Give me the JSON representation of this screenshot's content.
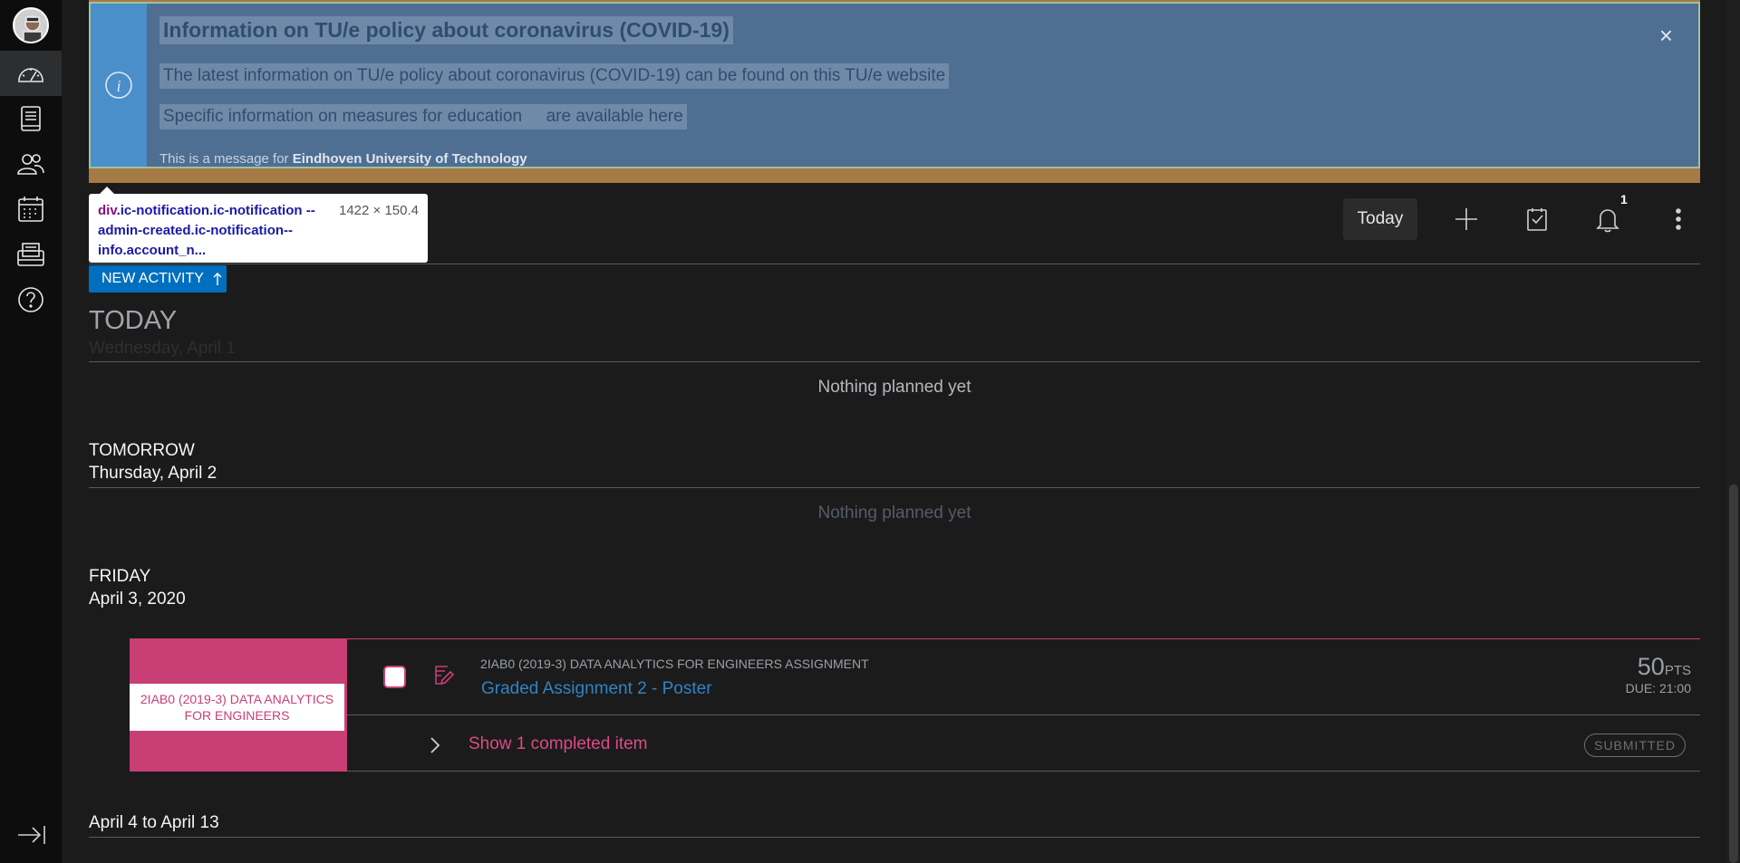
{
  "notification": {
    "title": "Information on TU/e policy about coronavirus (COVID-19)",
    "line1": "The latest information on TU/e policy about coronavirus (COVID-19) can be found on this TU/e website",
    "line2_a": "Specific information on measures for education",
    "line2_b": "are available here",
    "message_prefix": "This is a message for",
    "message_org": "Eindhoven University of Technology",
    "close": "×"
  },
  "devtools_tooltip": {
    "selector_tag": "div",
    "selector_classes": ".ic-notification.ic-notification --admin-created.ic-notification-- info.account_n...",
    "dimensions": "1422 × 150.4"
  },
  "header": {
    "today_button": "Today",
    "notification_count": "1",
    "icons": [
      "plus-icon",
      "todo-icon",
      "bell-icon",
      "more-vertical-icon"
    ]
  },
  "new_activity_label": "NEW ACTIVITY",
  "days": [
    {
      "title": "TODAY",
      "date": "Wednesday, April 1",
      "empty_text": "Nothing planned yet"
    },
    {
      "title": "TOMORROW",
      "date": "Thursday, April 2",
      "empty_text": "Nothing planned yet"
    },
    {
      "title": "FRIDAY",
      "date": "April 3, 2020"
    }
  ],
  "activity": {
    "course_tile": "2IAB0 (2019-3) DATA ANALYTICS FOR ENGINEERS",
    "course_line": "2IAB0 (2019-3) DATA ANALYTICS FOR ENGINEERS ASSIGNMENT",
    "title": "Graded Assignment 2 - Poster",
    "points": "50",
    "points_unit": "PTS",
    "due": "DUE: 21:00",
    "show_completed": "Show 1 completed item",
    "status": "SUBMITTED",
    "course_color": "#c93e74"
  },
  "range_heading": "April 4 to April 13",
  "sidebar": {
    "items": [
      "avatar",
      "dashboard-icon",
      "courses-icon",
      "groups-icon",
      "calendar-icon",
      "inbox-icon",
      "help-icon"
    ],
    "collapse": "collapse-nav-icon"
  }
}
